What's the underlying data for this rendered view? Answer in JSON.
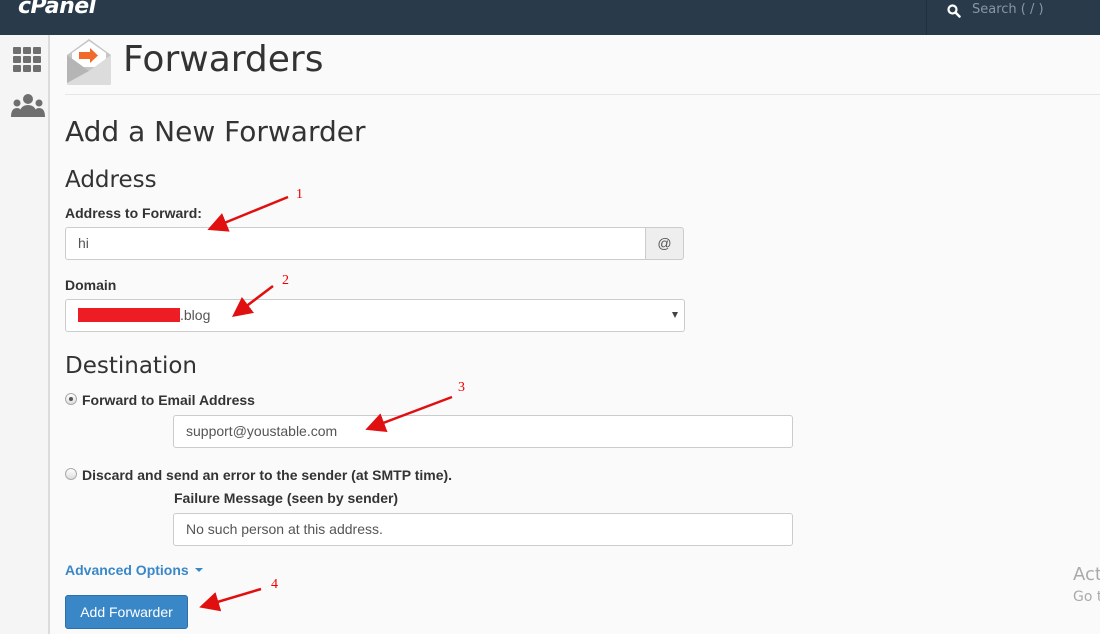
{
  "topbar": {
    "logo": "cPanel",
    "search_placeholder": "Search ( / )"
  },
  "sidebar": {
    "items": [
      {
        "name": "home-grid",
        "icon": "grid-icon"
      },
      {
        "name": "users",
        "icon": "users-icon"
      }
    ]
  },
  "header": {
    "icon": "forwarders-envelope-icon",
    "title": "Forwarders"
  },
  "form": {
    "heading": "Add a New Forwarder",
    "address_section": "Address",
    "address_label": "Address to Forward:",
    "address_value": "hi",
    "address_addon": "@",
    "domain_label": "Domain",
    "domain_value_suffix": ".blog",
    "domain_redacted": true,
    "destination_section": "Destination",
    "forward_option_label": "Forward to Email Address",
    "forward_option_checked": true,
    "forward_email_value": "support@youstable.com",
    "discard_option_label": "Discard and send an error to the sender (at SMTP time).",
    "discard_option_checked": false,
    "failure_label": "Failure Message (seen by sender)",
    "failure_value": "No such person at this address.",
    "advanced_label": "Advanced Options",
    "submit_label": "Add Forwarder"
  },
  "annotations": [
    "1",
    "2",
    "3",
    "4"
  ],
  "watermark": {
    "line1": "Act",
    "line2": "Go t"
  }
}
